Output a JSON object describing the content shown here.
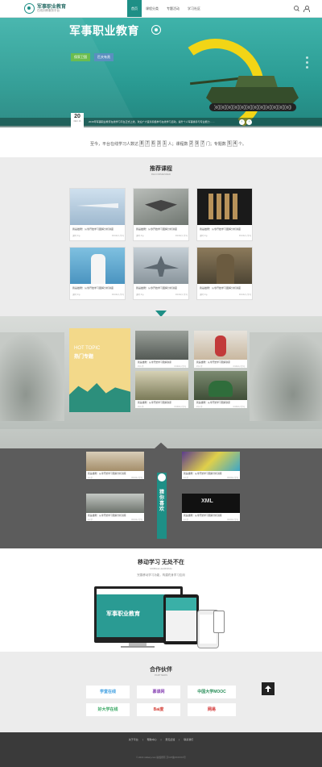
{
  "header": {
    "logo_title": "军事职业教育",
    "logo_subtitle": "在线训练服务平台",
    "nav": [
      "首页",
      "课程分类",
      "专题活动",
      "学习社区"
    ],
    "search_icon": "search-icon",
    "user_icon": "user-icon"
  },
  "banner": {
    "title": "军事职业教育",
    "button1": "保家卫国",
    "button2": "匹夫有责",
    "news_day": "20",
    "news_month": "DEC 16",
    "news_text": "2016年军事职业教育在线学习平台正式上线，欢迎广大官兵积极参与在线学习活动，提升个人军事素养与专业能力……"
  },
  "stats": {
    "prefix": "至今，平台在线学习人数达",
    "learners": [
      "8",
      "7",
      "6",
      "3",
      "1"
    ],
    "mid1": "人；课程数",
    "courses": [
      "2",
      "9",
      "7"
    ],
    "mid2": "门；专题数",
    "topics": [
      "5",
      "4"
    ],
    "suffix": "个。"
  },
  "recommend": {
    "title": "推荐课程",
    "subtitle": "RECOMMENDED",
    "cards": [
      {
        "caption": "我是雄鹰！从零开始学习图解分析讲座",
        "left": "课时 4节",
        "right": "0/1042人学习"
      },
      {
        "caption": "我是雄鹰！从零开始学习图解分析讲座",
        "left": "课时 4节",
        "right": "0/1042人学习"
      },
      {
        "caption": "我是雄鹰！从零开始学习图解分析讲座",
        "left": "课时 4节",
        "right": "0/1042人学习"
      },
      {
        "caption": "我是雄鹰！从零开始学习图解分析讲座",
        "left": "课时 4节",
        "right": "0/1042人学习"
      },
      {
        "caption": "我是雄鹰！从零开始学习图解分析讲座",
        "left": "课时 4节",
        "right": "0/1042人学习"
      },
      {
        "caption": "我是雄鹰！从零开始学习图解分析讲座",
        "left": "课时 4节",
        "right": "0/1042人学习"
      }
    ]
  },
  "hot": {
    "en": "HOT TOPIC",
    "cn": "热门专题",
    "cards": [
      {
        "caption": "我是雄鹰！从零开始学习图解讲座",
        "left": "15人学",
        "right": "0/1042人学习"
      },
      {
        "caption": "我是雄鹰！从零开始学习图解讲座",
        "left": "15人学",
        "right": "0/1042人学习"
      },
      {
        "caption": "我是雄鹰！从零开始学习图解讲座",
        "left": "15人学",
        "right": "0/1042人学习"
      },
      {
        "caption": "我是雄鹰！从零开始学习图解讲座",
        "left": "15人学",
        "right": "0/1042人学习"
      }
    ]
  },
  "guess": {
    "label": "猜你喜欢",
    "cards": [
      {
        "caption": "我是雄鹰！从零开始学习图解分析讲座",
        "left": "2人学",
        "right": "0/1042人学习"
      },
      {
        "caption": "我是雄鹰！从零开始学习图解分析讲座",
        "left": "2人学",
        "right": "0/1042人学习"
      },
      {
        "caption": "我是雄鹰！从零开始学习图解分析讲座",
        "left": "2人学",
        "right": "0/1042人学习"
      },
      {
        "caption": "我是雄鹰！从零开始学习图解分析讲座",
        "left": "2人学",
        "right": "0/1042人学习"
      }
    ]
  },
  "mobile": {
    "title": "移动学习 无处不在",
    "subtitle_en": "MOBILE LEARNING",
    "subtitle": "完善移动学习功能，构建终身学习应用",
    "screen_title": "军事职业教育"
  },
  "partners": {
    "title": "合作伙伴",
    "subtitle": "PARTNERS",
    "logos": [
      "学堂在线",
      "慕课网",
      "中国大学MOOC",
      "好大学在线",
      "Bai度",
      "网易"
    ]
  },
  "footer": {
    "links": [
      "关于平台",
      "帮助中心",
      "意见反馈",
      "联系我们"
    ],
    "copyright": "© 2016 military.com  版权所有 京ICP备XXXXXX号"
  },
  "colors": {
    "accent": "#1e8f86",
    "yellow": "#f2d516",
    "dark": "#5c5c5c"
  }
}
